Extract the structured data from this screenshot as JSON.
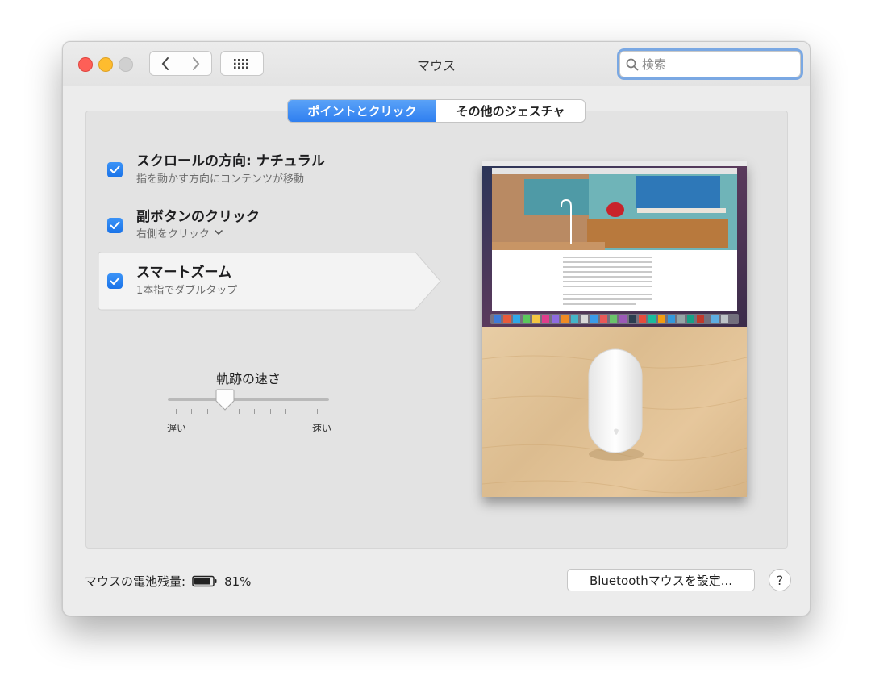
{
  "window": {
    "title": "マウス"
  },
  "search": {
    "placeholder": "検索"
  },
  "tabs": [
    {
      "label": "ポイントとクリック",
      "selected": true
    },
    {
      "label": "その他のジェスチャ",
      "selected": false
    }
  ],
  "options": [
    {
      "title": "スクロールの方向: ナチュラル",
      "subtitle": "指を動かす方向にコンテンツが移動",
      "checked": true
    },
    {
      "title": "副ボタンのクリック",
      "subtitle": "右側をクリック",
      "checked": true
    },
    {
      "title": "スマートズーム",
      "subtitle": "1本指でダブルタップ",
      "checked": true
    }
  ],
  "tracking": {
    "label": "軌跡の速さ",
    "min_label": "遅い",
    "max_label": "速い",
    "value": 0.35
  },
  "battery": {
    "label": "マウスの電池残量:",
    "percent": "81%"
  },
  "bluetooth_button": "Bluetoothマウスを設定...",
  "help_button": "?",
  "colors": {
    "accent": "#2f7ff0",
    "close": "#fe5f57",
    "minimize": "#febc2e"
  }
}
